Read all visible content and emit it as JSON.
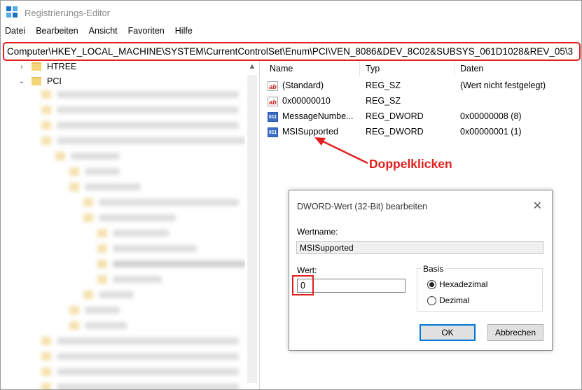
{
  "window": {
    "title": "Registrierungs-Editor"
  },
  "menu": [
    "Datei",
    "Bearbeiten",
    "Ansicht",
    "Favoriten",
    "Hilfe"
  ],
  "address": "Computer\\HKEY_LOCAL_MACHINE\\SYSTEM\\CurrentControlSet\\Enum\\PCI\\VEN_8086&DEV_8C02&SUBSYS_061D1028&REV_05\\3",
  "tree": {
    "items": [
      {
        "label": "HTREE",
        "expander": "›"
      },
      {
        "label": "PCI",
        "expander": "⌄"
      }
    ]
  },
  "list": {
    "columns": [
      "Name",
      "Typ",
      "Daten"
    ],
    "rows": [
      {
        "name": "(Standard)",
        "type": "REG_SZ",
        "data": "(Wert nicht festgelegt)",
        "icon": "string-value-icon"
      },
      {
        "name": "0x00000010",
        "type": "REG_SZ",
        "data": "",
        "icon": "string-value-icon"
      },
      {
        "name": "MessageNumbe...",
        "type": "REG_DWORD",
        "data": "0x00000008 (8)",
        "icon": "dword-value-icon"
      },
      {
        "name": "MSISupported",
        "type": "REG_DWORD",
        "data": "0x00000001 (1)",
        "icon": "dword-value-icon"
      }
    ]
  },
  "annotation": {
    "text": "Doppelklicken",
    "color": "#e0201e"
  },
  "dialog": {
    "title": "DWORD-Wert (32-Bit) bearbeiten",
    "close": "✕",
    "name_label": "Wertname:",
    "name_value": "MSISupported",
    "value_label": "Wert:",
    "value": "0",
    "basis_label": "Basis",
    "radio_hex": "Hexadezimal",
    "radio_dec": "Dezimal",
    "selected_basis": "Hexadezimal",
    "ok": "OK",
    "cancel": "Abbrechen"
  },
  "colors": {
    "highlight": "#e0201e",
    "accent": "#0078d7"
  }
}
